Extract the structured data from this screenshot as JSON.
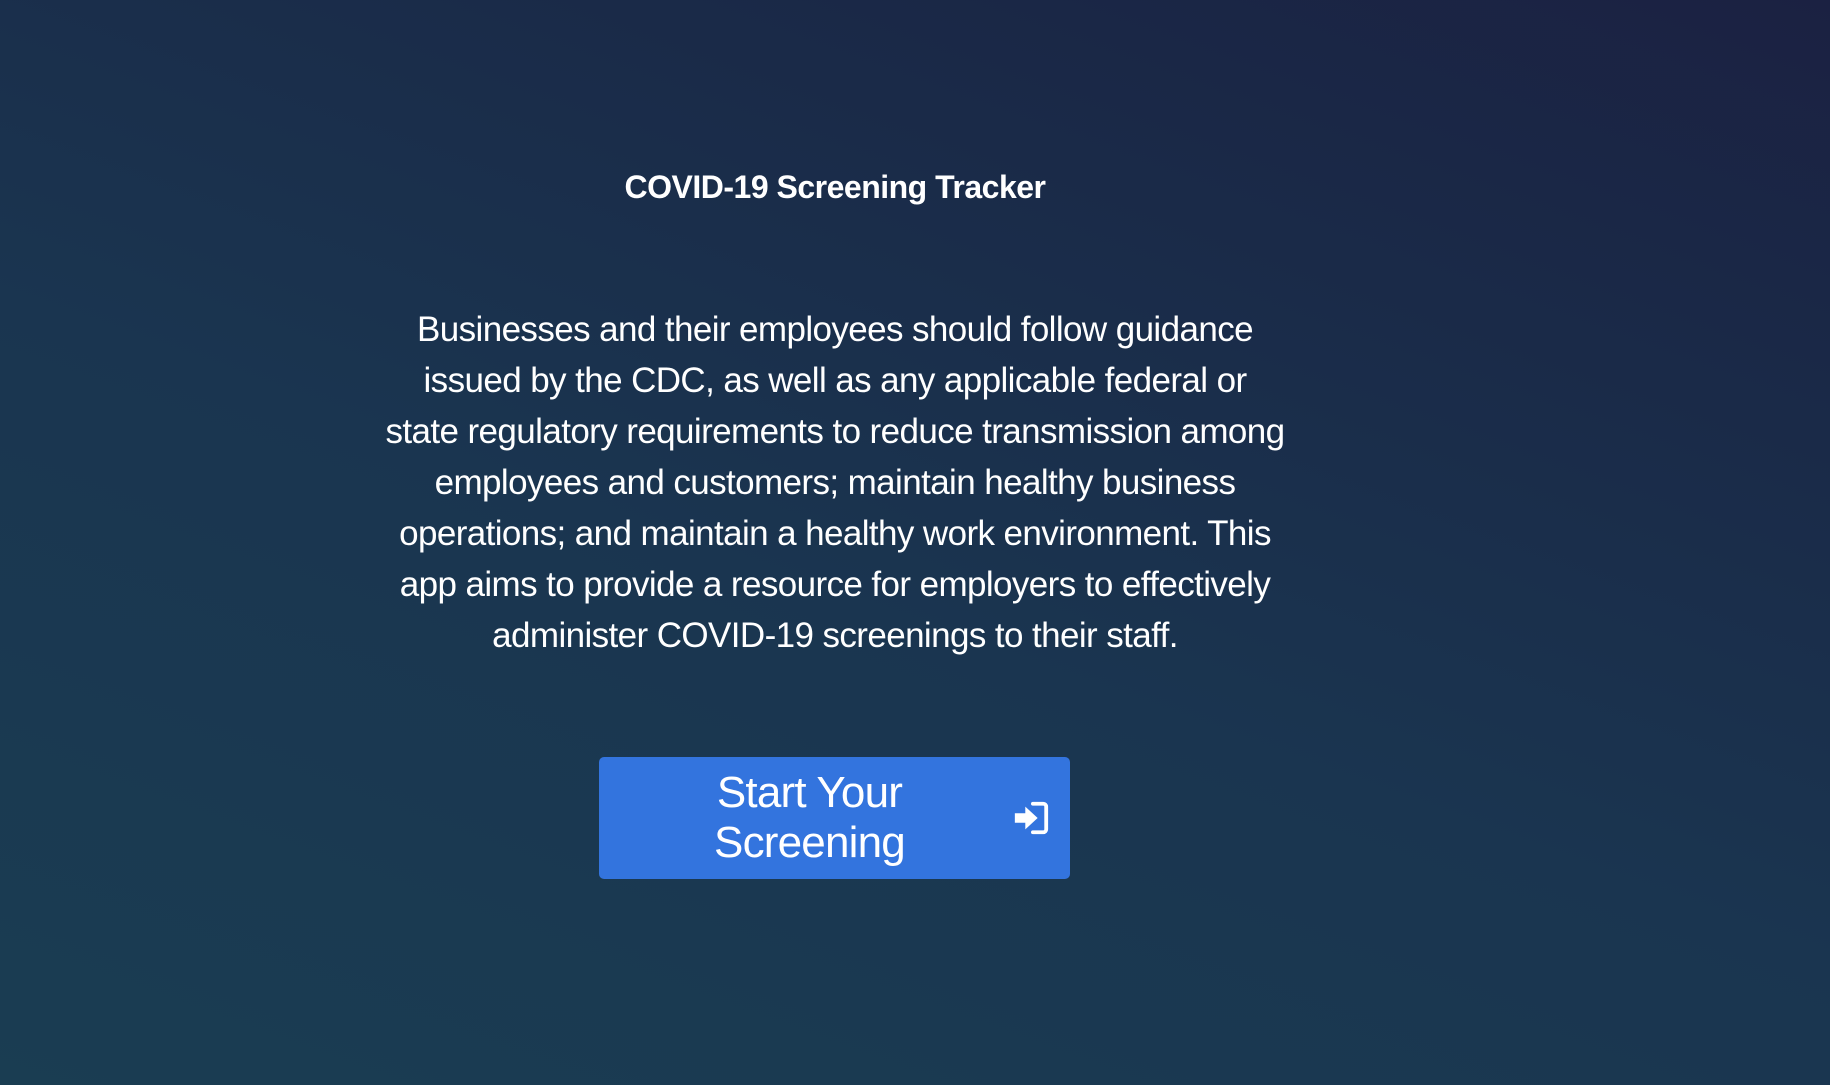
{
  "hero": {
    "title": "COVID-19 Screening Tracker",
    "description": "Businesses and their employees should follow guidance issued by the CDC, as well as any applicable federal or state regulatory requirements to reduce transmission among employees and customers; maintain healthy business operations; and maintain a healthy work environment. This app aims to provide a resource for employers to effectively administer COVID-19 screenings to their staff.",
    "cta": {
      "label": "Start Your Screening",
      "icon": "sign-in-icon"
    }
  },
  "colors": {
    "background_start": "#1a3d52",
    "background_end": "#1b2142",
    "button": "#3374de",
    "text": "#ffffff"
  }
}
